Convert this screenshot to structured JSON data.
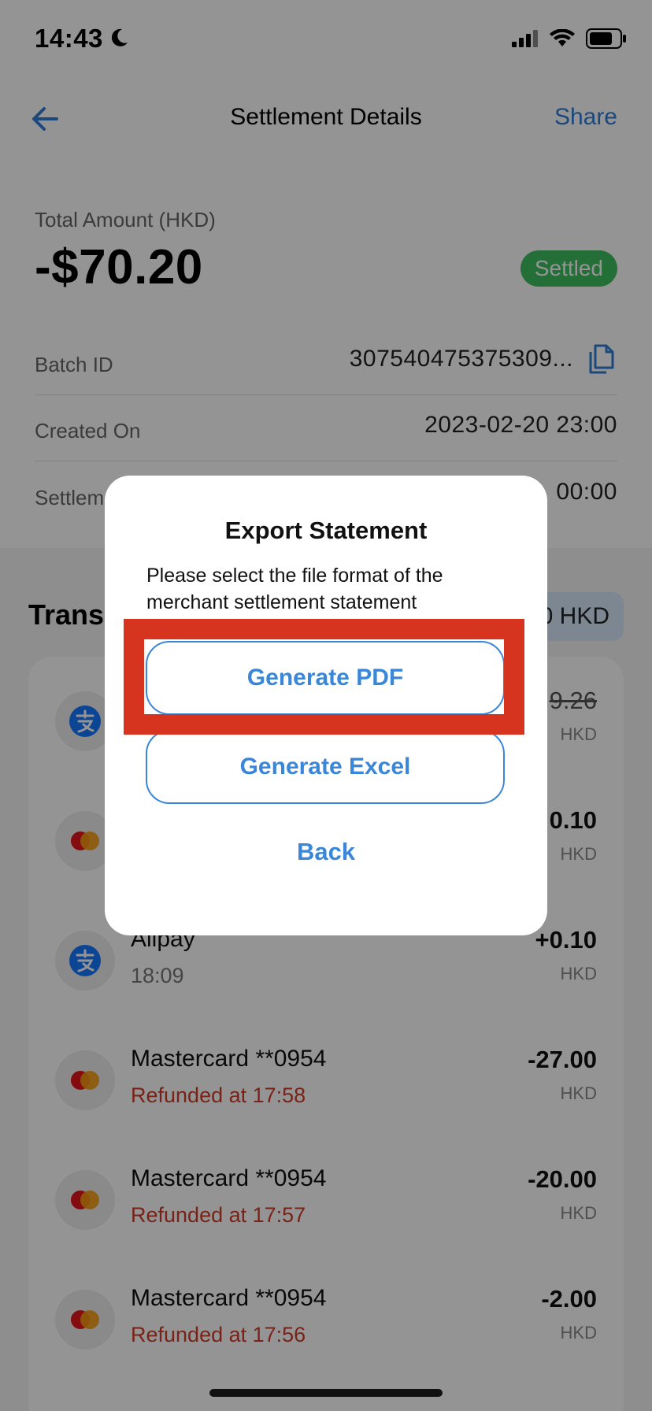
{
  "status_bar": {
    "time": "14:43"
  },
  "nav": {
    "title": "Settlement Details",
    "share": "Share"
  },
  "summary": {
    "amount_label": "Total Amount (HKD)",
    "amount": "-$70.20",
    "status": "Settled",
    "status_color": "#3fbf5f"
  },
  "details": [
    {
      "label": "Batch ID",
      "value": "307540475375309..."
    },
    {
      "label": "Created On",
      "value": "2023-02-20 23:00"
    },
    {
      "label": "Settlem",
      "value": "00:00"
    }
  ],
  "transactions": {
    "title": "Transa",
    "total": "0 HKD",
    "items": [
      {
        "icon": "alipay-icon",
        "name": "",
        "sub": "",
        "amount": "9.26",
        "currency": "HKD",
        "struck": true
      },
      {
        "icon": "mastercard-icon",
        "name": "",
        "sub": "",
        "amount": "0.10",
        "currency": "HKD"
      },
      {
        "icon": "alipay-icon",
        "name": "Alipay",
        "sub": "18:09",
        "amount": "+0.10",
        "currency": "HKD"
      },
      {
        "icon": "mastercard-icon",
        "name": "Mastercard **0954",
        "sub": "Refunded at 17:58",
        "amount": "-27.00",
        "currency": "HKD"
      },
      {
        "icon": "mastercard-icon",
        "name": "Mastercard **0954",
        "sub": "Refunded at 17:57",
        "amount": "-20.00",
        "currency": "HKD"
      },
      {
        "icon": "mastercard-icon",
        "name": "Mastercard **0954",
        "sub": "Refunded at 17:56",
        "amount": "-2.00",
        "currency": "HKD"
      }
    ]
  },
  "modal": {
    "title": "Export Statement",
    "description": "Please select the file format of the merchant settlement statement",
    "pdf_button": "Generate PDF",
    "excel_button": "Generate Excel",
    "back_button": "Back"
  },
  "colors": {
    "accent": "#3a86d8",
    "highlight": "#d6341f",
    "refund": "#d23b2a"
  }
}
